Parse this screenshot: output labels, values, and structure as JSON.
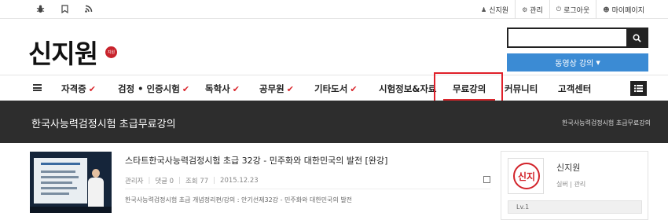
{
  "topbar": {
    "left_icons": [
      "bug-icon",
      "bookmark-icon",
      "rss-icon"
    ],
    "links": [
      {
        "icon": "user-icon",
        "label": "신지원"
      },
      {
        "icon": "gear-icon",
        "label": "관리"
      },
      {
        "icon": "power-icon",
        "label": "로그아웃"
      },
      {
        "icon": "user-circle-icon",
        "label": "마이페이지"
      }
    ]
  },
  "header": {
    "logo_text": "신지원",
    "logo_seal": "지원",
    "search_placeholder": "",
    "video_button_label": "동영상 강의"
  },
  "nav": {
    "items": [
      {
        "label": "자격증",
        "checked": true
      },
      {
        "label": "검정 • 인증시험",
        "checked": true
      },
      {
        "label": "독학사",
        "checked": true
      },
      {
        "label": "공무원",
        "checked": true
      },
      {
        "label": "기타도서",
        "checked": true
      },
      {
        "label": "시험정보&자료",
        "checked": false
      },
      {
        "label": "무료강의",
        "checked": false,
        "active": true
      },
      {
        "label": "커뮤니티",
        "checked": false
      },
      {
        "label": "고객센터",
        "checked": false
      }
    ]
  },
  "banner": {
    "title": "한국사능력검정시험 초급무료강의",
    "breadcrumb": "한국사능력검정시험 초급무료강의"
  },
  "post": {
    "title": "스타트한국사능력검정시험 초급 32강 - 민주화와 대한민국의 발전 [완강]",
    "author": "관리자",
    "comments": "댓글 0",
    "views": "조회 77",
    "date": "2015.12.23",
    "description": "한국사능력검정시험 초급 개념정리편/강의 : 안기선제32강 - 민주화와 대한민국의 발전"
  },
  "profile": {
    "avatar_text": "신지",
    "name": "신지원",
    "role": "실버 | 관리",
    "level": "Lv.1"
  },
  "colors": {
    "accent_red": "#d9262c",
    "button_blue": "#3b8bd4",
    "banner_dark": "#2d2d2d"
  }
}
